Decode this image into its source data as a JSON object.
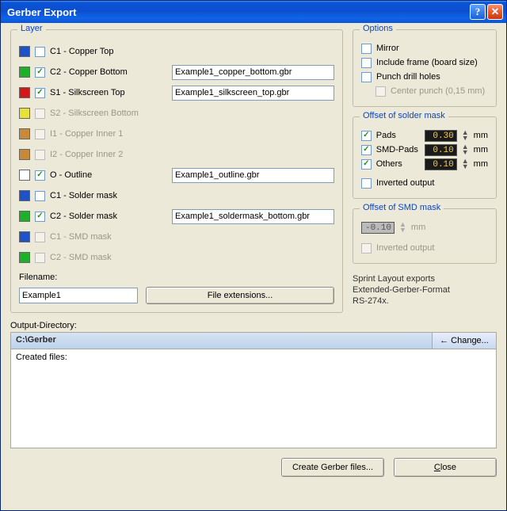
{
  "window": {
    "title": "Gerber Export"
  },
  "layer": {
    "legend": "Layer",
    "items": [
      {
        "swatch": "#1f51c7",
        "checked": false,
        "disabled": false,
        "label": "C1 - Copper Top",
        "input": null
      },
      {
        "swatch": "#1fb02a",
        "checked": true,
        "disabled": false,
        "label": "C2 - Copper Bottom",
        "input": "Example1_copper_bottom.gbr"
      },
      {
        "swatch": "#d21919",
        "checked": true,
        "disabled": false,
        "label": "S1 - Silkscreen Top",
        "input": "Example1_silkscreen_top.gbr"
      },
      {
        "swatch": "#e6e23a",
        "checked": false,
        "disabled": true,
        "label": "S2 - Silkscreen Bottom",
        "input": null
      },
      {
        "swatch": "#c78a3a",
        "checked": false,
        "disabled": true,
        "label": "I1 - Copper Inner 1",
        "input": null
      },
      {
        "swatch": "#c78a3a",
        "checked": false,
        "disabled": true,
        "label": "I2 - Copper Inner 2",
        "input": null
      },
      {
        "swatch": "#ffffff",
        "checked": true,
        "disabled": false,
        "label": "O - Outline",
        "input": "Example1_outline.gbr"
      },
      {
        "swatch": "#1f51c7",
        "checked": false,
        "disabled": false,
        "label": "C1 - Solder mask",
        "input": null
      },
      {
        "swatch": "#1fb02a",
        "checked": true,
        "disabled": false,
        "label": "C2 - Solder mask",
        "input": "Example1_soldermask_bottom.gbr"
      },
      {
        "swatch": "#1f51c7",
        "checked": false,
        "disabled": true,
        "label": "C1 - SMD mask",
        "input": null
      },
      {
        "swatch": "#1fb02a",
        "checked": false,
        "disabled": true,
        "label": "C2 - SMD mask",
        "input": null
      }
    ],
    "filename_label": "Filename:",
    "filename_value": "Example1",
    "file_ext_btn": "File extensions..."
  },
  "options": {
    "legend": "Options",
    "mirror": {
      "label": "Mirror",
      "checked": false
    },
    "include_frame": {
      "label": "Include frame (board size)",
      "checked": false
    },
    "punch_drill": {
      "label": "Punch drill holes",
      "checked": false
    },
    "center_punch": {
      "label": "Center punch (0,15 mm)",
      "checked": false,
      "disabled": true
    }
  },
  "solder_mask": {
    "legend": "Offset of solder mask",
    "pads": {
      "label": "Pads",
      "checked": true,
      "value": "0.30",
      "unit": "mm"
    },
    "smd": {
      "label": "SMD-Pads",
      "checked": true,
      "value": "0.10",
      "unit": "mm"
    },
    "others": {
      "label": "Others",
      "checked": true,
      "value": "0.10",
      "unit": "mm"
    },
    "inverted": {
      "label": "Inverted output",
      "checked": false
    }
  },
  "smd_mask": {
    "legend": "Offset of SMD mask",
    "value": "-0.10",
    "unit": "mm",
    "inverted": {
      "label": "Inverted output",
      "checked": false,
      "disabled": true
    }
  },
  "info": {
    "line1": "Sprint Layout exports",
    "line2": "Extended-Gerber-Format",
    "line3": "RS-274x."
  },
  "outdir": {
    "label": "Output-Directory:",
    "path": "C:\\Gerber",
    "change": "Change...",
    "arrow": "←"
  },
  "created": {
    "label": "Created files:"
  },
  "buttons": {
    "create": "Create Gerber files...",
    "close": "Close"
  }
}
